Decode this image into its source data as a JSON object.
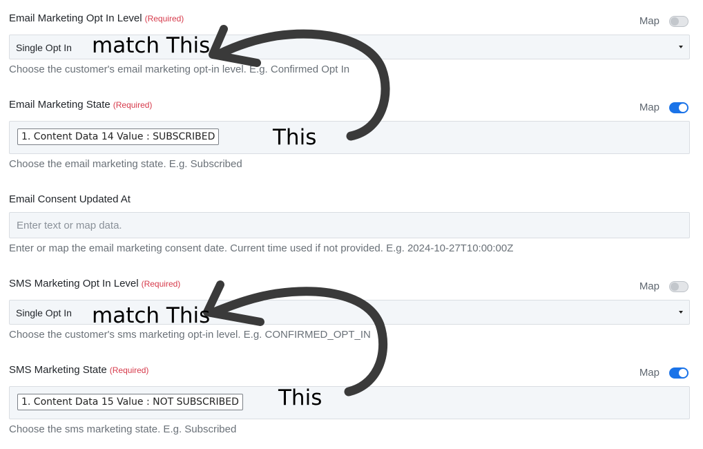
{
  "fields": {
    "email_opt_in": {
      "label": "Email Marketing Opt In Level",
      "required": "(Required)",
      "map_label": "Map",
      "map_enabled": false,
      "value": "Single Opt In",
      "help": "Choose the customer's email marketing opt-in level. E.g. Confirmed Opt In"
    },
    "email_state": {
      "label": "Email Marketing State",
      "required": "(Required)",
      "map_label": "Map",
      "map_enabled": true,
      "chip": "1. Content Data 14 Value : SUBSCRIBED",
      "help": "Choose the email marketing state. E.g. Subscribed"
    },
    "email_consent": {
      "label": "Email Consent Updated At",
      "placeholder": "Enter text or map data.",
      "value": "",
      "help": "Enter or map the email marketing consent date. Current time used if not provided. E.g. 2024-10-27T10:00:00Z"
    },
    "sms_opt_in": {
      "label": "SMS Marketing Opt In Level",
      "required": "(Required)",
      "map_label": "Map",
      "map_enabled": false,
      "value": "Single Opt In",
      "help": "Choose the customer's sms marketing opt-in level. E.g. CONFIRMED_OPT_IN"
    },
    "sms_state": {
      "label": "SMS Marketing State",
      "required": "(Required)",
      "map_label": "Map",
      "map_enabled": true,
      "chip": "1. Content Data 15 Value : NOT SUBSCRIBED",
      "help": "Choose the sms marketing state. E.g. Subscribed"
    }
  },
  "annotations": {
    "match_1": "match This",
    "this_1": "This",
    "match_2": "match This",
    "this_2": "This"
  },
  "colors": {
    "toggle_on": "#1a73e8",
    "required": "#d6394a"
  }
}
